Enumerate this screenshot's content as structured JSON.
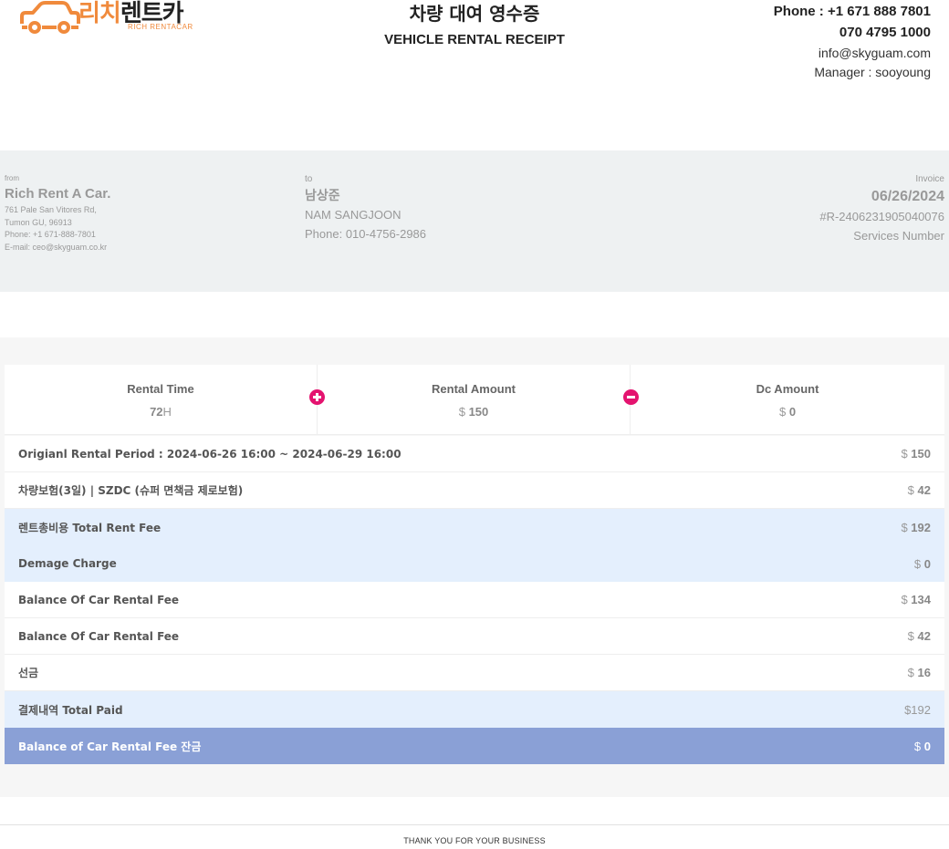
{
  "logo": {
    "ko_part1": "리치",
    "ko_part2": "렌트카",
    "en": "RICH RENTACAR",
    "brand_color": "#f08a3c"
  },
  "header": {
    "title_ko": "차량 대여 영수증",
    "title_en": "VEHICLE RENTAL RECEIPT"
  },
  "contact": {
    "phone": "Phone : +1 671 888 7801",
    "phone2": "070 4795 1000",
    "email": "info@skyguam.com",
    "manager": "Manager : sooyoung"
  },
  "from": {
    "label": "from",
    "name": "Rich Rent A Car.",
    "address1": "761 Pale San Vitores Rd,",
    "address2": "Tumon GU, 96913",
    "phone": "Phone: +1 671-888-7801",
    "email": "E-mail: ceo@skyguam.co.kr"
  },
  "to": {
    "label": "to",
    "name_ko": "남상준",
    "name_en": "NAM SANGJOON",
    "phone": "Phone: 010-4756-2986"
  },
  "invoice": {
    "label": "Invoice",
    "date": "06/26/2024",
    "number": "#R-2406231905040076",
    "services": "Services Number"
  },
  "summary": {
    "rental_time": {
      "label": "Rental Time",
      "value": "72",
      "unit": "H"
    },
    "rental_amount": {
      "label": "Rental Amount",
      "currency": "$",
      "value": "150"
    },
    "dc_amount": {
      "label": "Dc Amount",
      "currency": "$",
      "value": "0"
    },
    "plus_icon": "plus-circle-icon",
    "minus_icon": "minus-circle-icon",
    "accent_color": "#e4136f"
  },
  "rows": [
    {
      "label": "Origianl Rental Period : 2024-06-26 16:00 ~ 2024-06-29 16:00",
      "currency": "$",
      "amount": "150"
    },
    {
      "label": "차량보험(3일) | SZDC (슈퍼 면책금 제로보험)",
      "currency": "$",
      "amount": "42"
    },
    {
      "label": "렌트총비용 Total Rent Fee",
      "currency": "$",
      "amount": "192"
    },
    {
      "label": "Demage Charge",
      "currency": "$",
      "amount": "0"
    },
    {
      "label": "Balance Of Car Rental Fee",
      "currency": "$",
      "amount": "134"
    },
    {
      "label": "Balance Of Car Rental Fee",
      "currency": "$",
      "amount": "42"
    },
    {
      "label": "선금",
      "currency": "$",
      "amount": "16"
    },
    {
      "label": "결제내역 Total Paid",
      "currency": "$",
      "amount": "192"
    },
    {
      "label": "Balance of Car Rental Fee 잔금",
      "currency": "$",
      "amount": "0"
    }
  ],
  "footer": {
    "text": "THANK YOU FOR YOUR BUSINESS"
  }
}
